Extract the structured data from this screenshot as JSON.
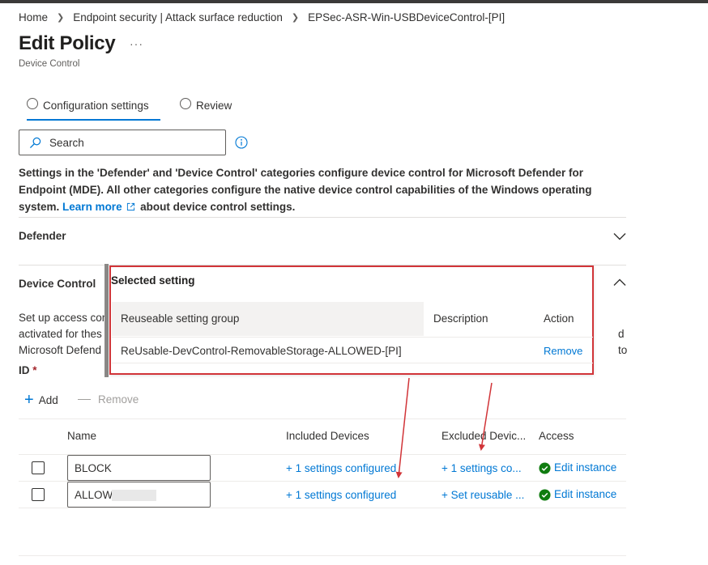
{
  "breadcrumb": {
    "items": [
      "Home",
      "Endpoint security | Attack surface reduction",
      "EPSec-ASR-Win-USBDeviceControl-[PI]"
    ]
  },
  "page": {
    "title": "Edit Policy",
    "subtitle": "Device Control",
    "more": "···"
  },
  "tabs": {
    "config": "Configuration settings",
    "review": "Review"
  },
  "search": {
    "placeholder": "Search"
  },
  "description": {
    "line1": "Settings in the 'Defender' and 'Device Control' categories configure device control for Microsoft Defender for",
    "line2": "Endpoint (MDE). All other categories configure the native device control capabilities of the Windows operating",
    "line3_pre": "system. ",
    "learn_more": "Learn more",
    "line3_post": " about device control settings."
  },
  "sections": {
    "defender": "Defender",
    "device_control": "Device Control"
  },
  "device_control": {
    "desc_line1": "Set up access con",
    "desc_line2": "activated for thes",
    "desc_line3": "Microsoft Defend",
    "desc_right": "d to",
    "id_label": "ID",
    "required": "*",
    "add": "Add",
    "remove": "Remove"
  },
  "table": {
    "headers": [
      "Name",
      "Included Devices",
      "Excluded Devic...",
      "Access"
    ],
    "rows": [
      {
        "name": "BLOCK",
        "included": "+ 1 settings configured",
        "excluded": "+ 1 settings co...",
        "access": "Edit instance"
      },
      {
        "name": "ALLOW",
        "included": "+ 1 settings configured",
        "excluded": "+ Set reusable ...",
        "access": "Edit instance"
      }
    ]
  },
  "popup": {
    "title": "Selected setting",
    "headers": [
      "Reuseable setting group",
      "Description",
      "Action"
    ],
    "row": {
      "group": "ReUsable-DevControl-RemovableStorage-ALLOWED-[PI]",
      "description": "",
      "action": "Remove"
    }
  },
  "colors": {
    "accent": "#0078d4",
    "highlight_border": "#d13438",
    "success": "#107c10"
  }
}
